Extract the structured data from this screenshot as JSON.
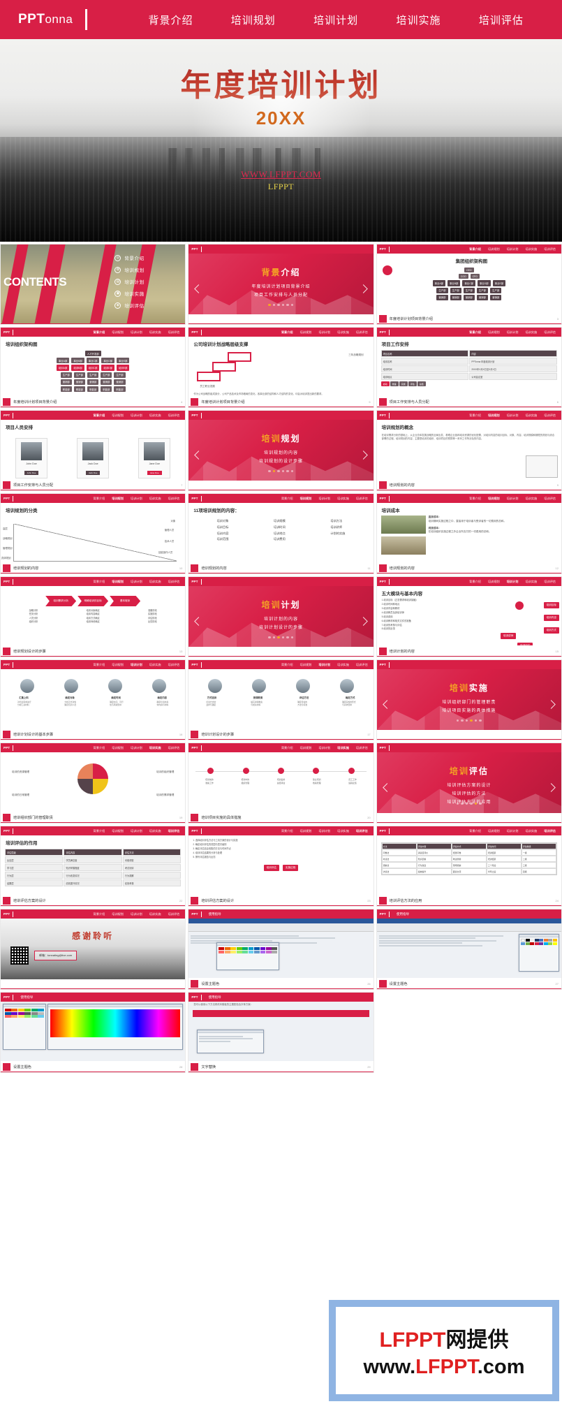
{
  "header": {
    "logo_main": "PPT",
    "logo_sub": "onna",
    "nav": [
      {
        "label": "背景介绍"
      },
      {
        "label": "培训规划"
      },
      {
        "label": "培训计划"
      },
      {
        "label": "培训实施"
      },
      {
        "label": "培训评估"
      }
    ]
  },
  "hero": {
    "title": "年度培训计划",
    "subtitle": "20XX",
    "watermark_url": "WWW.LFPPT.COM",
    "watermark_brand": "LFPPT"
  },
  "thumb_nav": {
    "logo_main": "PPT",
    "logo_sub": "onna",
    "items": [
      "背景介绍",
      "培训规划",
      "培训计划",
      "培训实施",
      "培训评估"
    ]
  },
  "contents_slide": {
    "word": "CONTENTS",
    "menu": [
      {
        "icon": "target-icon",
        "glyph": "◎",
        "label": "背景介绍"
      },
      {
        "icon": "gear-icon",
        "glyph": "✿",
        "label": "培训规划"
      },
      {
        "icon": "book-icon",
        "glyph": "▤",
        "label": "培训计划"
      },
      {
        "icon": "gamepad-icon",
        "glyph": "▣",
        "label": "培训实施"
      },
      {
        "icon": "chart-icon",
        "glyph": "◈",
        "label": "培训评估"
      }
    ]
  },
  "sections": {
    "s1": {
      "title_a": "背景",
      "title_b": "介绍",
      "l1": "年度培训计划项目背景介绍",
      "l2": "项目工作安排与人员分配",
      "l3": ""
    },
    "s2": {
      "title_a": "培训",
      "title_b": "规划",
      "l1": "培训规划的内容",
      "l2": "培训规划的设计步骤",
      "l3": ""
    },
    "s3": {
      "title_a": "培训",
      "title_b": "计划",
      "l1": "培训计划的内容",
      "l2": "培训计划设计的步骤",
      "l3": ""
    },
    "s4": {
      "title_a": "培训",
      "title_b": "实施",
      "l1": "培训组织部门的管理职责",
      "l2": "培训项目实施的具体措施",
      "l3": ""
    },
    "s5": {
      "title_a": "培训",
      "title_b": "评估",
      "l1": "培训评估方案的设计",
      "l2": "培训评估的方法",
      "l3": "培训评估方法的应用"
    }
  },
  "captions": {
    "bg": "年度培训计划项目背景介绍",
    "assign": "项目工作安排与人员分配",
    "planContent": "培训规划的内容",
    "planSteps": "培训规划设计的步骤",
    "trainPlanSteps": "培训计划设计的基本步骤",
    "implement": "培训组织部门的管理职责",
    "implementMeasure": "培训项目实施的具体措施",
    "evalDesign": "培训评估方案的设计",
    "evalApply": "培训评估方法的应用",
    "themeColor": "设置主题色",
    "guide": "使用指导",
    "fontGuide": "文字替换"
  },
  "slides": [
    {
      "id": 1,
      "type": "contents",
      "caption": ""
    },
    {
      "id": 2,
      "type": "section",
      "section": "s1",
      "caption": ""
    },
    {
      "id": 3,
      "type": "orgchart",
      "title": "集团组织架构图",
      "caption": "年度培训计划项目背景介绍",
      "page": "3"
    },
    {
      "id": 4,
      "type": "orgchart2",
      "title": "培训组织架构图",
      "caption": "年度培训计划项目背景介绍",
      "page": "4"
    },
    {
      "id": 5,
      "type": "strategy",
      "title": "公司培训计划战略层级支撑",
      "caption": "年度培训计划项目背景介绍",
      "page": "5"
    },
    {
      "id": 6,
      "type": "table",
      "title": "项目工作安排",
      "caption": "项目工作安排与人员分配",
      "page": "6"
    },
    {
      "id": 7,
      "type": "people",
      "title": "项目人员安排",
      "caption": "项目工作安排与人员分配",
      "page": "7"
    },
    {
      "id": 8,
      "type": "section",
      "section": "s2",
      "caption": ""
    },
    {
      "id": 9,
      "type": "concept",
      "title": "培训规划的概念",
      "caption": "培训规划的内容",
      "page": "9"
    },
    {
      "id": 10,
      "type": "quadrant",
      "title": "培训规划的分类",
      "caption": "培训规划的内容",
      "page": "10"
    },
    {
      "id": 11,
      "type": "list2col",
      "title": "11项培训规划的内容：",
      "caption": "培训规划的内容",
      "page": "11"
    },
    {
      "id": 12,
      "type": "cost",
      "title": "培训成本",
      "caption": "培训规划的内容",
      "page": "12"
    },
    {
      "id": 13,
      "type": "chevrons",
      "title": "培训规划设计的步骤",
      "caption": "培训规划设计的步骤",
      "page": "13"
    },
    {
      "id": 14,
      "type": "section",
      "section": "s3",
      "caption": ""
    },
    {
      "id": 15,
      "type": "fivemod",
      "title": "五大模块与基本内容",
      "caption": "培训计划的内容",
      "page": "15"
    },
    {
      "id": 16,
      "type": "timeline",
      "title": "培训计划设计的基本步骤",
      "caption": "培训计划设计的基本步骤",
      "page": "16"
    },
    {
      "id": 17,
      "type": "timeline2",
      "title": "培训计划设计的步骤",
      "caption": "培训计划设计的步骤",
      "page": "17"
    },
    {
      "id": 18,
      "type": "section",
      "section": "s4",
      "caption": ""
    },
    {
      "id": 19,
      "type": "pie",
      "title": "培训的组织管理",
      "caption": "培训组织部门的管理职责",
      "page": "19"
    },
    {
      "id": 20,
      "type": "timeline3",
      "title": "培训项目实施的具体措施",
      "caption": "培训项目实施的具体措施",
      "page": "20"
    },
    {
      "id": 21,
      "type": "section",
      "section": "s5",
      "caption": ""
    },
    {
      "id": 22,
      "type": "evaltable",
      "title": "培训评估的作用",
      "caption": "培训评估方案的设计",
      "page": "22"
    },
    {
      "id": 23,
      "type": "evaldiagram",
      "title": "培训评估方案的设计",
      "caption": "培训评估方案的设计",
      "page": "23"
    },
    {
      "id": 24,
      "type": "bigtable",
      "title": "培训评估方法的应用",
      "caption": "培训评估方法的应用",
      "page": "24"
    },
    {
      "id": 25,
      "type": "thanks",
      "title": "感谢聆听",
      "caption": "",
      "page": "25"
    },
    {
      "id": 26,
      "type": "guide1",
      "title": "使用指导",
      "caption": "设置主题色",
      "page": "26"
    },
    {
      "id": 27,
      "type": "guide2",
      "title": "使用指导",
      "caption": "设置主题色",
      "page": "27"
    },
    {
      "id": 28,
      "type": "guide3",
      "title": "使用指导",
      "caption": "设置主题色",
      "page": "28"
    },
    {
      "id": 29,
      "type": "guide4",
      "title": "使用指导",
      "caption": "文字替换",
      "page": "29"
    }
  ],
  "org": {
    "top": "CEO",
    "second": [
      "COO",
      "CFO"
    ],
    "depts": [
      "事业A部",
      "事业B部",
      "事业C部",
      "事业D部",
      "事业E部"
    ],
    "rows": [
      [
        "培训A部",
        "培训B部",
        "培训C部",
        "培训D部",
        "培训E部"
      ],
      [
        "生产部",
        "生产部",
        "生产部",
        "生产部",
        "生产部"
      ],
      [
        "营销部",
        "营销部",
        "营销部",
        "营销部",
        "营销部"
      ],
      [
        "职能部",
        "职能部",
        "职能部",
        "职能部",
        "职能部"
      ]
    ],
    "hr_top": "人才开发部"
  },
  "plan_content": {
    "left": [
      "培训对象",
      "培训目标",
      "培训内容",
      "培训范围"
    ],
    "mid": [
      "培训规模",
      "培训时间",
      "培训地点",
      "培训费用"
    ],
    "right": [
      "培训方法",
      "培训讲师",
      "计划的实施"
    ]
  },
  "five_modules": [
    "1.培训目标（正态需求和培训接触）",
    "2.培训时间和地点",
    "3.培训内容和教材",
    "4.培训教员及其培训师",
    "5.培训费用",
    "6.培训教材和相关文件的准备",
    "7.培训的考核与评估",
    "8.培训的反馈"
  ],
  "cost": {
    "h1": "直接成本：",
    "p1": "培训期间实施过程之中，直接用于培训者与受训者的一切费用的总和。",
    "h2": "间接成本：",
    "p2": "在培训组织实施过程之外企业所支付的一切费用的总和。"
  },
  "concept": {
    "text": "在培训需求分析的基础上，从企业总体发展战略的全局出发，着眼企业各种培训资源的优化配置，对培训内容的培训目标、对象、内容、培训规模和期限的规划与综合部署的过程。培训规划的内容，主要是培训的组织、培训项目的预算等一系列工作所涉及的内容。"
  },
  "theme": {
    "red": "#d81f46",
    "dark": "#55434a",
    "orange": "#f5a623",
    "yellow": "#e8d44a"
  },
  "overlay": {
    "line1_a": "LFPPT",
    "line1_b": "网提供",
    "line2_a": "www.",
    "line2_b": "LFPPT",
    "line2_c": ".com"
  },
  "thanks": {
    "title": "感谢聆听",
    "mail": "邮箱：tonnating@live.com"
  }
}
